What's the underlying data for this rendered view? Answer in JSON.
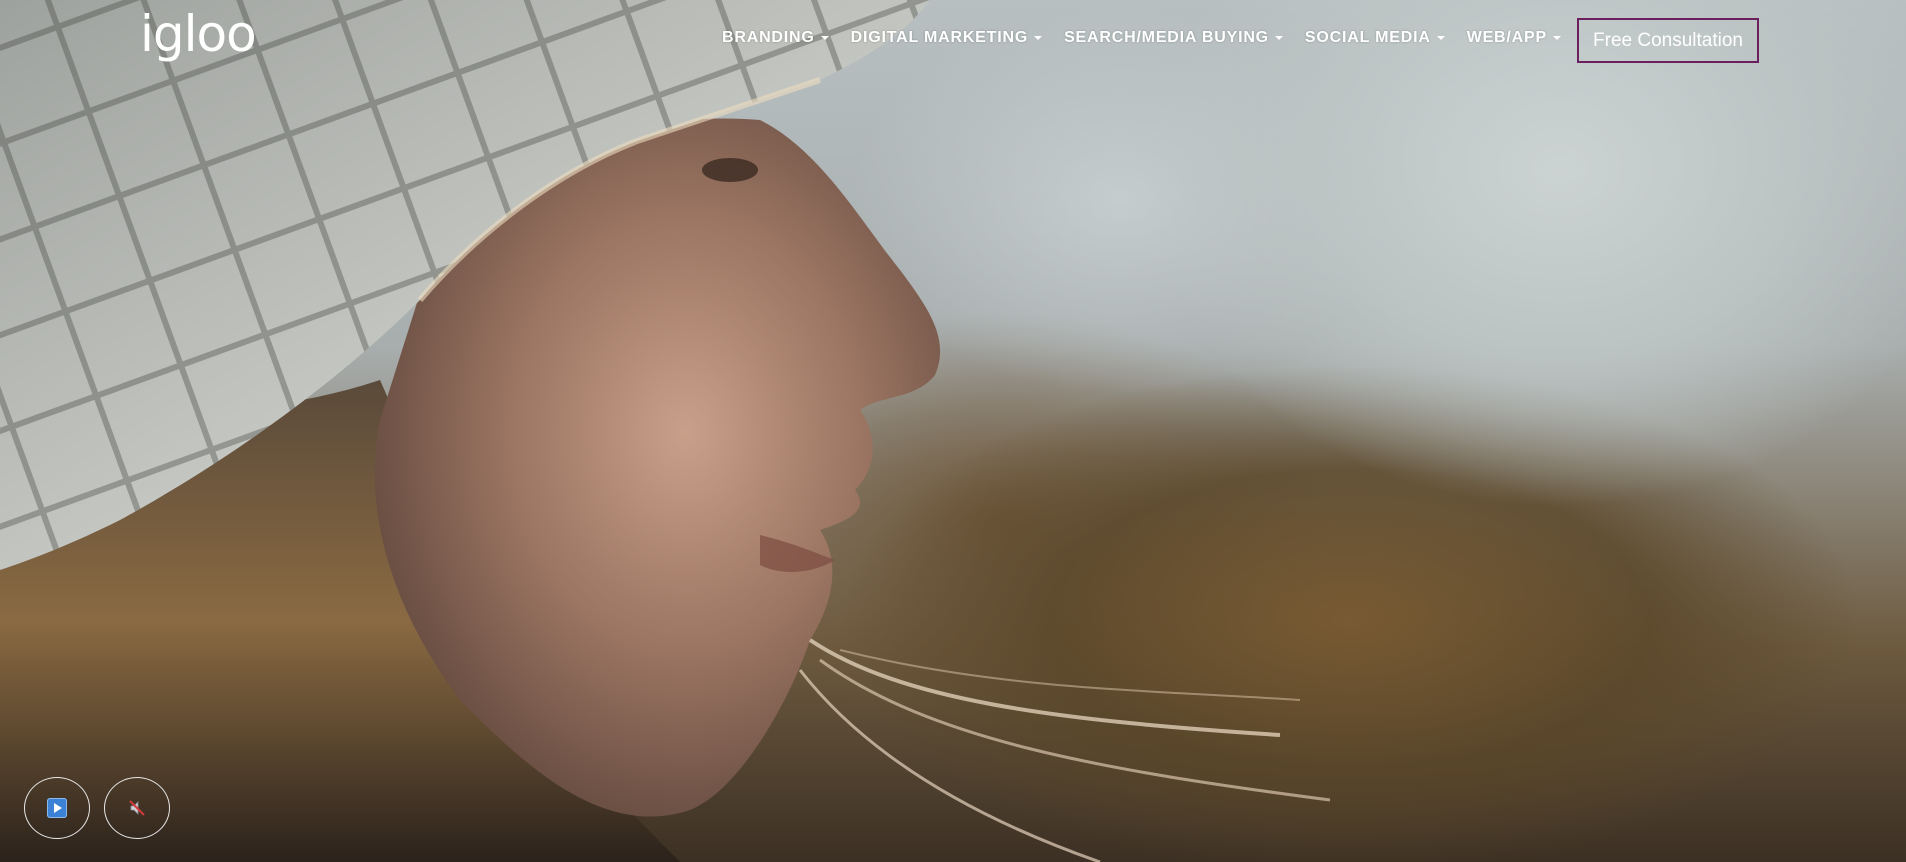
{
  "brand": {
    "logo_text": "igloo"
  },
  "nav": {
    "items": [
      {
        "label": "BRANDING",
        "icon": "caret-down-icon"
      },
      {
        "label": "DIGITAL MARKETING",
        "icon": "caret-down-icon"
      },
      {
        "label": "SEARCH/MEDIA BUYING",
        "icon": "caret-down-icon"
      },
      {
        "label": "SOCIAL MEDIA",
        "icon": "caret-down-icon"
      },
      {
        "label": "WEB/APP",
        "icon": "caret-down-icon"
      }
    ],
    "cta_label": "Free Consultation"
  },
  "video_controls": {
    "play_icon": "play-icon",
    "mute_icon": "muted-speaker-icon"
  },
  "colors": {
    "nav_text": "#ffffff",
    "cta_border": "#6b1f5e",
    "play_icon_fill": "#3b82d6"
  }
}
